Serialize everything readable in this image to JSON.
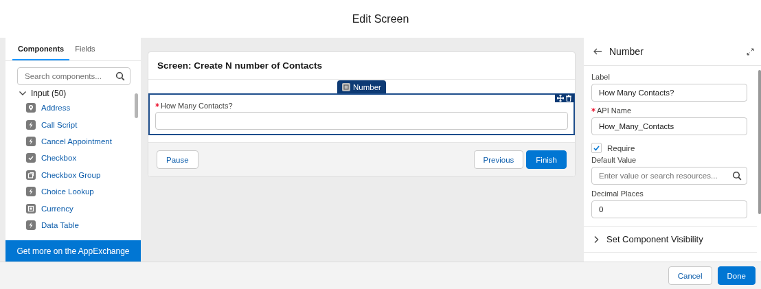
{
  "header": {
    "title": "Edit Screen"
  },
  "palette": {
    "tabs": [
      {
        "label": "Components",
        "selected": true
      },
      {
        "label": "Fields",
        "selected": false
      }
    ],
    "search": {
      "placeholder": "Search components..."
    },
    "group": {
      "label": "Input (50)",
      "expanded": true,
      "items": [
        {
          "label": "Address",
          "kind": "pin"
        },
        {
          "label": "Call Script",
          "kind": "bolt"
        },
        {
          "label": "Cancel Appointment",
          "kind": "bolt"
        },
        {
          "label": "Checkbox",
          "kind": "check"
        },
        {
          "label": "Checkbox Group",
          "kind": "checkgroup"
        },
        {
          "label": "Choice Lookup",
          "kind": "bolt"
        },
        {
          "label": "Currency",
          "kind": "box"
        },
        {
          "label": "Data Table",
          "kind": "bolt"
        }
      ]
    },
    "footer_link": "Get more on the AppExchange"
  },
  "canvas": {
    "title": "Screen: Create N number of Contacts",
    "component_tag": "Number",
    "field": {
      "label": "How Many Contacts?",
      "required": true
    },
    "buttons": [
      {
        "label": "Pause",
        "kind": "neutral"
      },
      {
        "label": "Previous",
        "kind": "neutral"
      },
      {
        "label": "Finish",
        "kind": "brand"
      }
    ]
  },
  "properties": {
    "title": "Number",
    "fields": [
      {
        "kind": "text",
        "label": "Label",
        "required": false,
        "value": "How Many Contacts?"
      },
      {
        "kind": "text",
        "label": "API Name",
        "required": true,
        "value": "How_Many_Contacts"
      },
      {
        "kind": "checkbox",
        "label": "Require",
        "checked": true
      },
      {
        "kind": "search",
        "label": "Default Value",
        "required": false,
        "placeholder": "Enter value or search resources..."
      },
      {
        "kind": "text",
        "label": "Decimal Places",
        "required": false,
        "value": "0"
      }
    ],
    "section": {
      "label": "Set Component Visibility",
      "expanded": false
    }
  },
  "footer": {
    "buttons": [
      {
        "label": "Cancel",
        "kind": "neutral"
      },
      {
        "label": "Done",
        "kind": "brand"
      }
    ]
  }
}
